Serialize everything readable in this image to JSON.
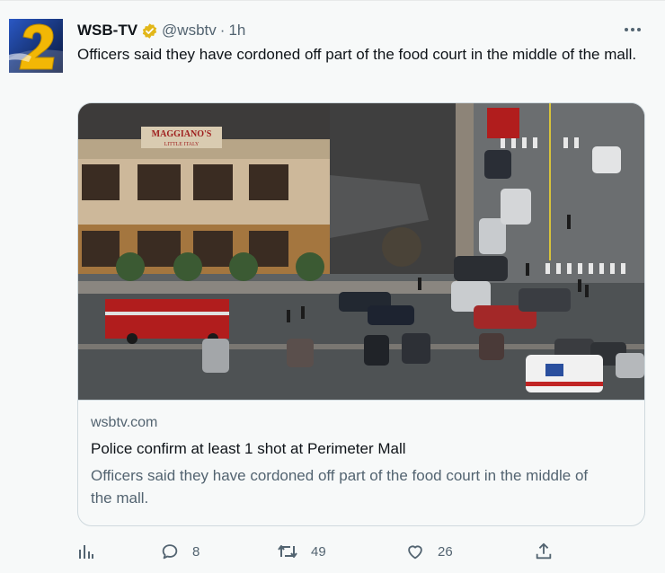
{
  "tweet": {
    "display_name": "WSB-TV",
    "handle": "@wsbtv",
    "separator": "·",
    "time": "1h",
    "text": "Officers said they have cordoned off part of the food court in the middle of the mall."
  },
  "card": {
    "domain": "wsbtv.com",
    "title": "Police confirm at least 1 shot at Perimeter Mall",
    "description": "Officers said they have cordoned off part of the food court in the middle of the mall.",
    "image_sign": [
      "MAGGIANO'S",
      "LITTLE ITALY"
    ]
  },
  "actions": {
    "views_icon": "analytics-icon",
    "reply_count": "8",
    "retweet_count": "49",
    "like_count": "26",
    "share_icon": "share-icon"
  },
  "colors": {
    "verified_badge": "#e2b719",
    "accent_text_secondary": "#536471",
    "avatar_blue": "#1d3f8f",
    "avatar_gold": "#f2b705"
  }
}
